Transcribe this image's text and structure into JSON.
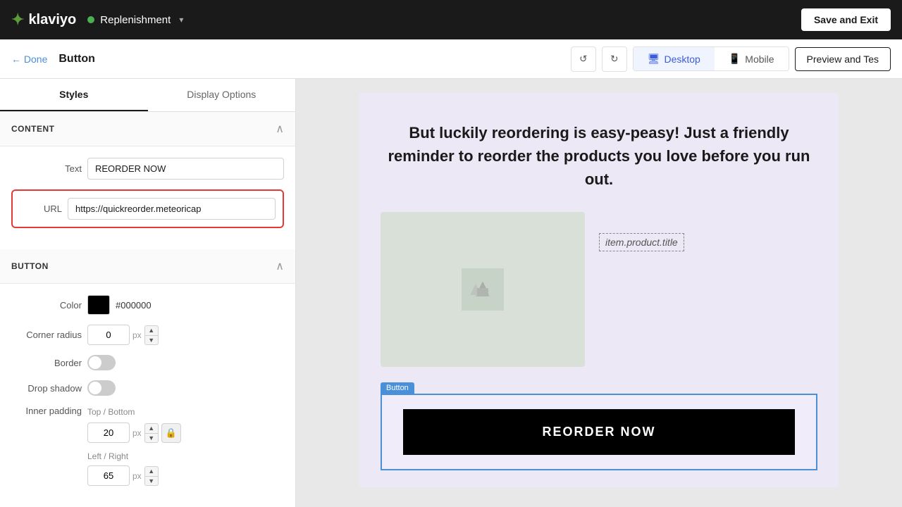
{
  "topNav": {
    "logoText": "klaviyo",
    "flowName": "Replenishment",
    "saveExitLabel": "Save and Exit"
  },
  "secondaryNav": {
    "doneLabel": "← Done",
    "title": "Button",
    "desktopLabel": "Desktop",
    "mobileLabel": "Mobile",
    "previewLabel": "Preview and Tes"
  },
  "tabs": [
    {
      "label": "Styles",
      "active": true
    },
    {
      "label": "Display Options",
      "active": false
    }
  ],
  "content": {
    "sectionTitle": "CONTENT",
    "textLabel": "Text",
    "textValue": "REORDER NOW",
    "urlLabel": "URL",
    "urlValue": "https://quickreorder.meteoricap"
  },
  "button": {
    "sectionTitle": "BUTTON",
    "colorLabel": "Color",
    "colorHex": "#000000",
    "colorSwatch": "#000000",
    "cornerRadiusLabel": "Corner radius",
    "cornerRadiusValue": "0",
    "cornerUnit": "px",
    "borderLabel": "Border",
    "dropShadowLabel": "Drop shadow",
    "innerPaddingLabel": "Inner padding",
    "topBottomLabel": "Top / Bottom",
    "topBottomValue": "20",
    "topBottomUnit": "px",
    "leftRightLabel": "Left / Right",
    "leftRightValue": "65",
    "leftRightUnit": "px"
  },
  "canvas": {
    "tagline": "But luckily reordering is easy-peasy! Just a friendly reminder to reorder the products you love before you run out.",
    "productTitleTag": "item.product.title",
    "buttonLabel": "Button",
    "reorderLabel": "REORDER NOW"
  },
  "icons": {
    "undo": "↺",
    "redo": "↻",
    "desktop": "🖥",
    "mobile": "📱",
    "collapse": "∧",
    "lock": "🔒",
    "copy": "⧉",
    "star": "★",
    "trash": "🗑",
    "lightning": "⚡"
  }
}
